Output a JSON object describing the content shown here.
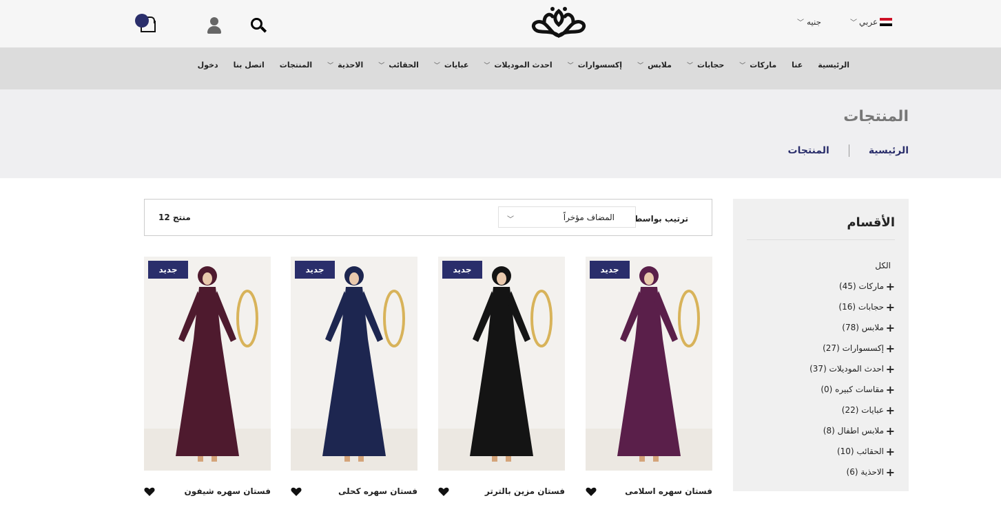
{
  "header": {
    "currency": "جنيه",
    "language": "عربي",
    "flag_colors": [
      "#ce1126",
      "#ffffff",
      "#000000"
    ],
    "icons": [
      "cart-icon",
      "user-icon",
      "search-icon"
    ],
    "accent": "#2a2e6b"
  },
  "nav": {
    "items": [
      {
        "label": "الرئيسية",
        "dropdown": false
      },
      {
        "label": "عنا",
        "dropdown": false
      },
      {
        "label": "ماركات",
        "dropdown": true
      },
      {
        "label": "حجابات",
        "dropdown": true
      },
      {
        "label": "ملابس",
        "dropdown": true
      },
      {
        "label": "إكسسوارات",
        "dropdown": true
      },
      {
        "label": "احدث الموديلات",
        "dropdown": true
      },
      {
        "label": "عبايات",
        "dropdown": true
      },
      {
        "label": "الحقائب",
        "dropdown": true
      },
      {
        "label": "الاحذية",
        "dropdown": true
      },
      {
        "label": "المنتجات",
        "dropdown": false
      },
      {
        "label": "اتصل بنا",
        "dropdown": false
      },
      {
        "label": "دخول",
        "dropdown": false
      }
    ]
  },
  "hero": {
    "title": "المنتجات",
    "breadcrumb": [
      "الرئيسية",
      "المنتجات"
    ]
  },
  "sidebar": {
    "title": "الأقسام",
    "all_label": "الكل",
    "categories": [
      "ماركات (45)",
      "حجابات (16)",
      "ملابس (78)",
      "إكسسوارات (27)",
      "احدث الموديلات (37)",
      "مقاسات كبيره (0)",
      "عبايات (22)",
      "ملابس اطفال (8)",
      "الحقائب (10)",
      "الاحذية (6)"
    ]
  },
  "toolbar": {
    "sort_label": "ترتيب بواسطة",
    "sort_value": "المضاف مؤخراً",
    "count": "12 منتج"
  },
  "products": [
    {
      "name": "فستان سهره اسلامى",
      "badge": "جديد",
      "color": "#5a1f4a"
    },
    {
      "name": "فستان مزين بالترتر",
      "badge": "جديد",
      "color": "#141414"
    },
    {
      "name": "فستان سهره كحلى",
      "badge": "جديد",
      "color": "#1d2650"
    },
    {
      "name": "فستان سهره شيفون",
      "badge": "جديد",
      "color": "#4e1a2e"
    }
  ]
}
